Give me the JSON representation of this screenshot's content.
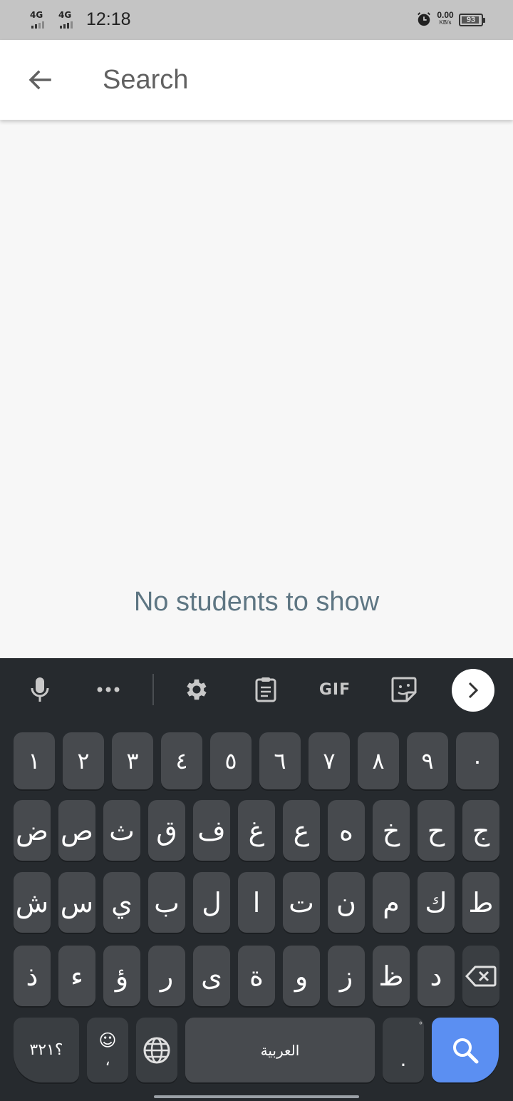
{
  "status_bar": {
    "signal_1": "4G",
    "signal_2": "4G",
    "time": "12:18",
    "net_speed_value": "0.00",
    "net_speed_unit": "KB/s",
    "battery": "93",
    "battery_level": 0.93
  },
  "app_bar": {
    "back_icon": "arrow-left-icon",
    "search_placeholder": "Search",
    "search_value": ""
  },
  "content": {
    "empty_message": "No students to show"
  },
  "keyboard": {
    "toolbar": [
      "mic-icon",
      "more-icon",
      "settings-icon",
      "clipboard-icon",
      "GIF",
      "sticker-icon",
      "chevron-right-icon"
    ],
    "gif_label": "GIF",
    "row_numbers": [
      "١",
      "٢",
      "٣",
      "٤",
      "٥",
      "٦",
      "٧",
      "٨",
      "٩",
      "٠"
    ],
    "row_1": [
      "ض",
      "ص",
      "ث",
      "ق",
      "ف",
      "غ",
      "ع",
      "ه",
      "خ",
      "ح",
      "ج"
    ],
    "row_2": [
      "ش",
      "س",
      "ي",
      "ب",
      "ل",
      "ا",
      "ت",
      "ن",
      "م",
      "ك",
      "ط"
    ],
    "row_3": [
      "ذ",
      "ء",
      "ؤ",
      "ر",
      "ى",
      "ة",
      "و",
      "ز",
      "ظ",
      "د"
    ],
    "symbols_key": "؟٣٢١",
    "comma_key": "،",
    "space_label": "العربية",
    "period_key": ".",
    "period_hint": "ْ",
    "accent_color": "#5b8ff2"
  }
}
